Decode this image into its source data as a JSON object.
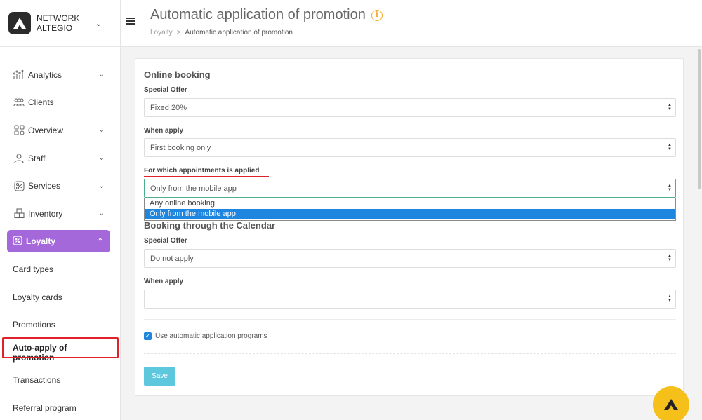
{
  "brand": {
    "line1": "NETWORK",
    "line2": "ALTEGIO"
  },
  "sidebar": {
    "items": [
      {
        "label": "Analytics",
        "icon": "analytics-icon",
        "has_chevron": true
      },
      {
        "label": "Clients",
        "icon": "clients-icon",
        "has_chevron": false
      },
      {
        "label": "Overview",
        "icon": "overview-icon",
        "has_chevron": true
      },
      {
        "label": "Staff",
        "icon": "staff-icon",
        "has_chevron": true
      },
      {
        "label": "Services",
        "icon": "services-icon",
        "has_chevron": true
      },
      {
        "label": "Inventory",
        "icon": "inventory-icon",
        "has_chevron": true
      },
      {
        "label": "Loyalty",
        "icon": "loyalty-icon",
        "has_chevron": true,
        "active": true
      }
    ],
    "subitems": [
      "Card types",
      "Loyalty cards",
      "Promotions",
      "Auto-apply of promotion",
      "Transactions",
      "Referral program"
    ]
  },
  "header": {
    "title": "Automatic application of promotion",
    "breadcrumb": {
      "parent": "Loyalty",
      "separator": ">",
      "current": "Automatic application of promotion"
    }
  },
  "online_booking": {
    "title": "Online booking",
    "special_offer_label": "Special Offer",
    "special_offer_value": "Fixed 20%",
    "when_apply_label": "When apply",
    "when_apply_value": "First booking only",
    "applied_label": "For which appointments is applied",
    "applied_value": "Only from the mobile app",
    "dropdown_options": [
      "Any online booking",
      "Only from the mobile app"
    ]
  },
  "calendar_booking": {
    "title": "Booking through the Calendar",
    "special_offer_label": "Special Offer",
    "special_offer_value": "Do not apply",
    "when_apply_label": "When apply",
    "when_apply_value": ""
  },
  "checkbox_label": "Use automatic application programs",
  "save_label": "Save",
  "colors": {
    "accent": "#a568db",
    "highlight": "#e0202a",
    "selection": "#1f86e0",
    "save": "#5dc7dd",
    "fab": "#f6c01b"
  }
}
